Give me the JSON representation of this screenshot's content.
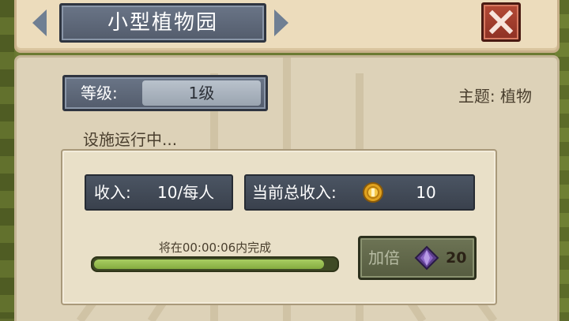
{
  "header": {
    "title": "小型植物园",
    "prev_icon": "chevron-left-icon",
    "next_icon": "chevron-right-icon",
    "close_icon": "close-icon"
  },
  "level": {
    "label": "等级:",
    "value": "1级"
  },
  "theme": {
    "text": "主题: 植物"
  },
  "status": {
    "text": "设施运行中..."
  },
  "income": {
    "label": "收入:",
    "value": "10/每人"
  },
  "total_income": {
    "label": "当前总收入:",
    "icon": "gold-coin-icon",
    "value": "10"
  },
  "progress": {
    "text": "将在00:00:06内完成",
    "fraction": 0.95
  },
  "double_button": {
    "label": "加倍",
    "icon": "purple-gem-icon",
    "cost": "20"
  },
  "colors": {
    "progress_fill": "#94ba4e",
    "close_button": "#a03e2d",
    "plate": "#5d6778"
  }
}
